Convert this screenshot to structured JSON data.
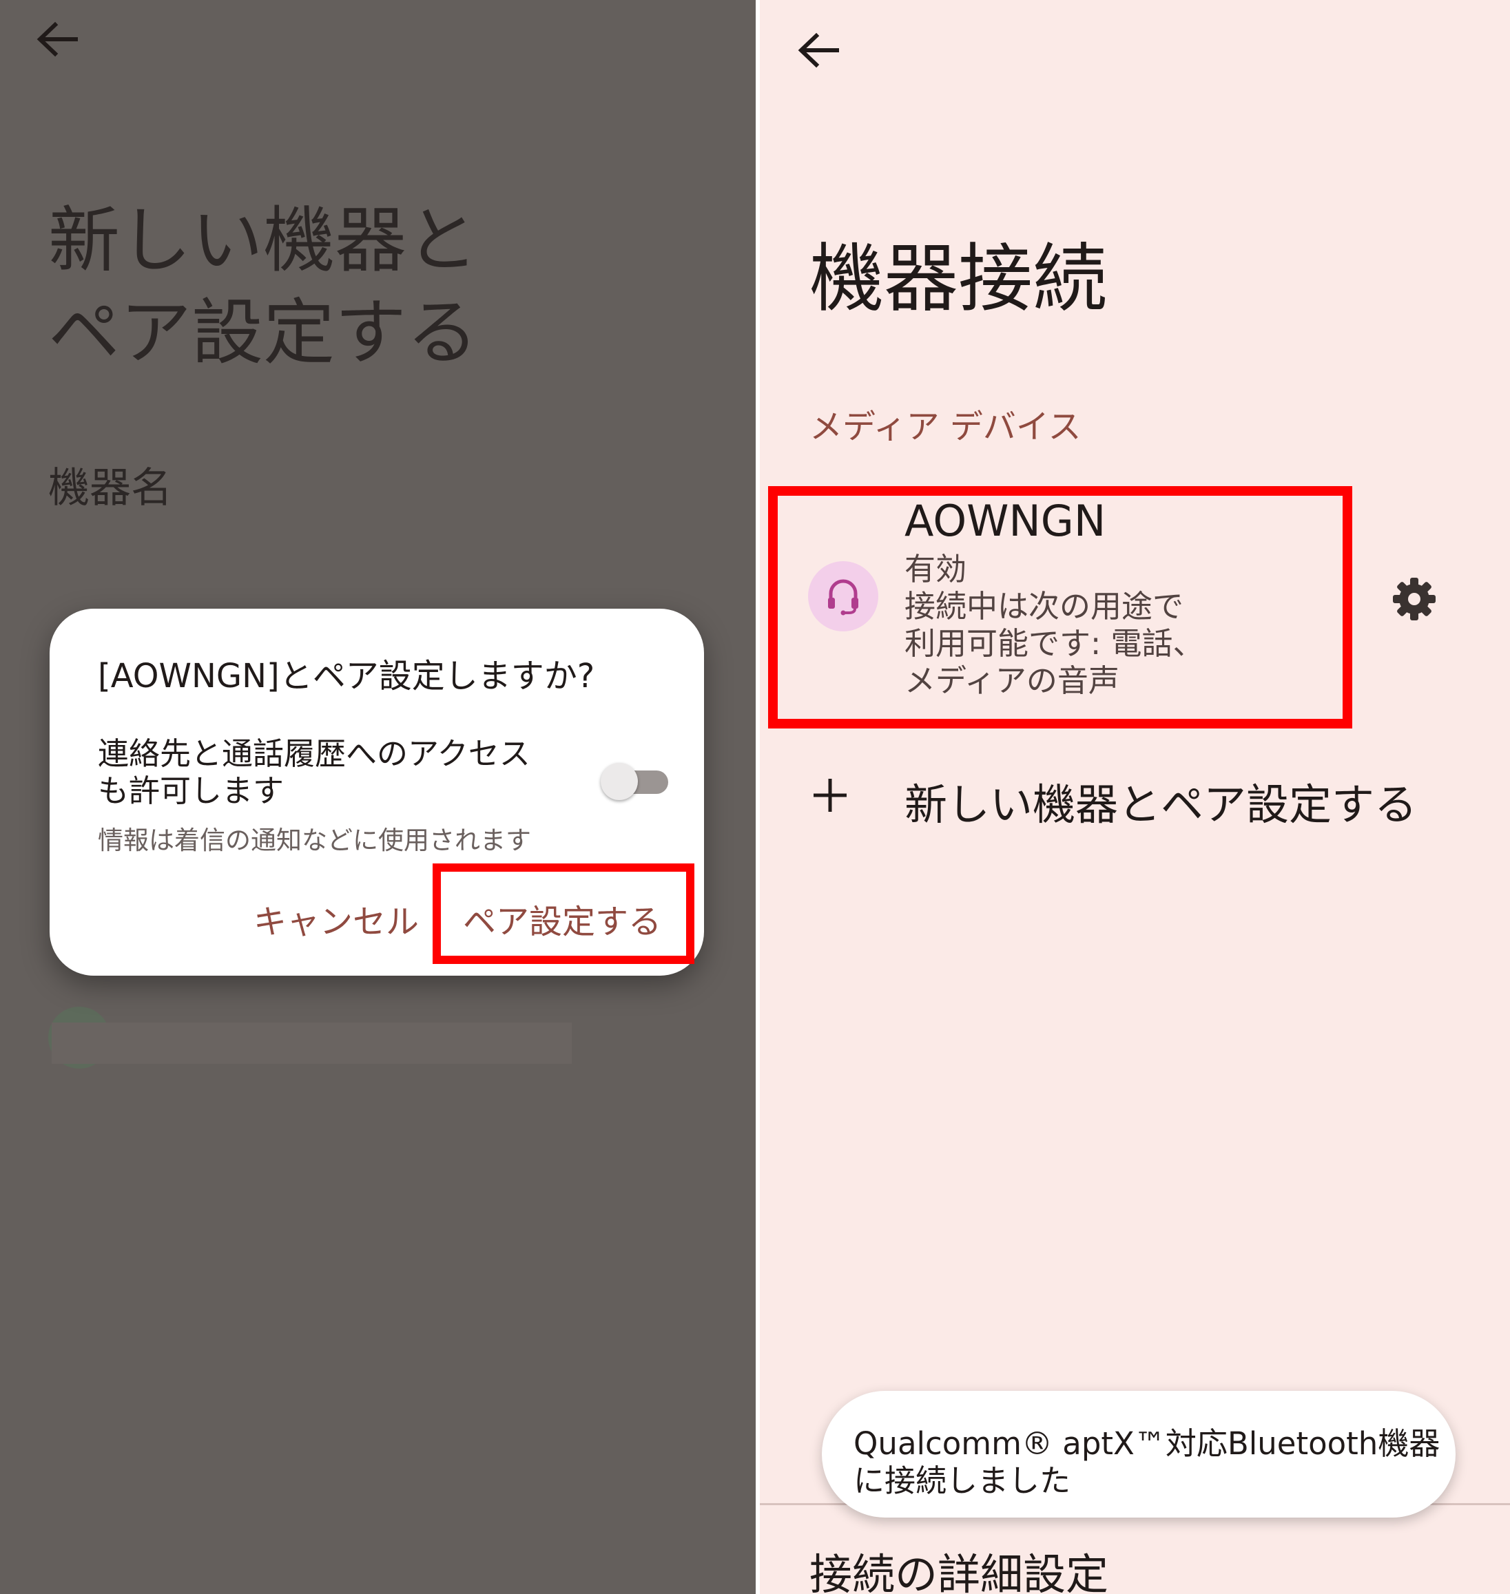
{
  "left_panel": {
    "title_line1": "新しい機器と",
    "title_line2": "ペア設定する",
    "device_name_label": "機器名",
    "dialog": {
      "title": "[AOWNGN]とペア設定しますか?",
      "access_line1": "連絡先と通話履歴へのアクセス",
      "access_line2": "も許可します",
      "note": "情報は着信の通知などに使用されます",
      "toggle_state": "off",
      "cancel_label": "キャンセル",
      "pair_label": "ペア設定する"
    }
  },
  "right_panel": {
    "title": "機器接続",
    "section_header": "メディア デバイス",
    "device": {
      "name": "AOWNGN",
      "status_line1": "有効",
      "status_line2": "接続中は次の用途で",
      "status_line3": "利用可能です: 電話、",
      "status_line4": "メディアの音声",
      "icon": "headset-icon"
    },
    "add_device_label": "新しい機器とペア設定する",
    "toast_line1": "Qualcomm® aptX™対応Bluetooth機器",
    "toast_line2": "に接続しました",
    "advanced_settings_label": "接続の詳細設定"
  },
  "colors": {
    "highlight_red": "#ff0000",
    "accent_brown": "#904a40",
    "left_scrim": "#645f5c",
    "right_bg": "#fbeae7",
    "icon_bg": "#f3cfea",
    "icon_fg": "#b03d8e"
  }
}
